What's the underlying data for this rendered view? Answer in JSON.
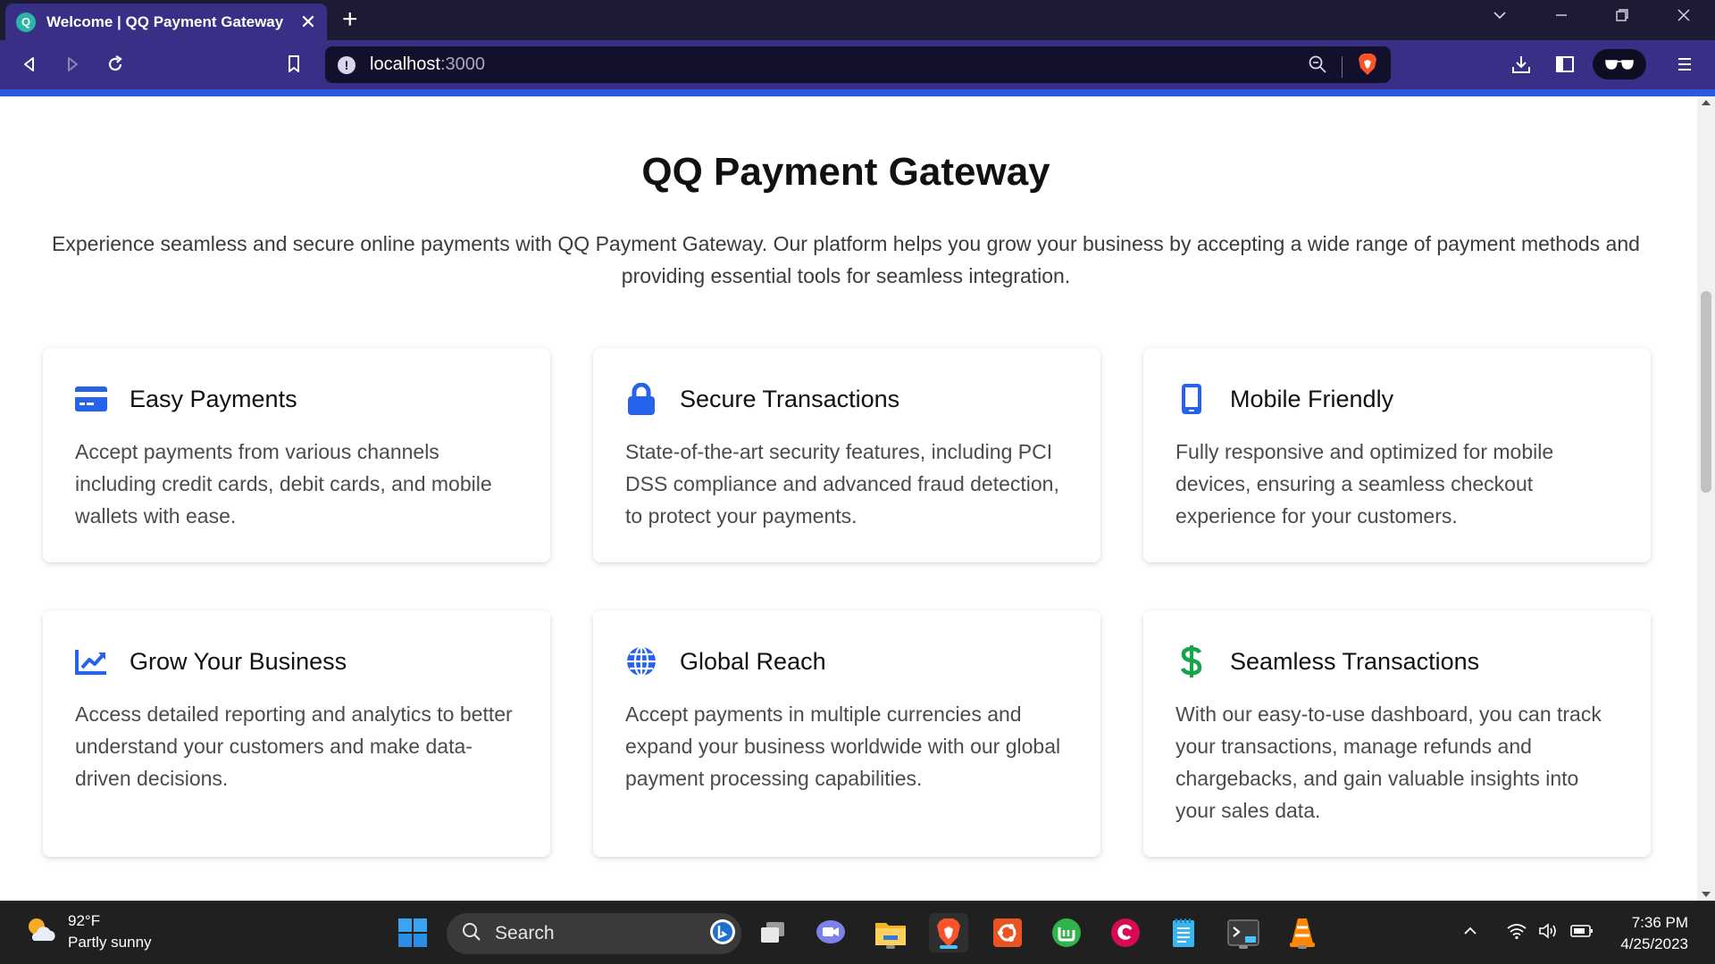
{
  "browser": {
    "tab_title": "Welcome | QQ Payment Gateway",
    "tab_favicon_letter": "Q",
    "new_tab_symbol": "+",
    "close_symbol": "✕",
    "url_host": "localhost",
    "url_port": ":3000",
    "accent_color": "#2c57e0"
  },
  "hero": {
    "title": "QQ Payment Gateway",
    "subtitle": "Experience seamless and secure online payments with QQ Payment Gateway. Our platform helps you grow your business by accepting a wide range of payment methods and providing essential tools for seamless integration."
  },
  "features": [
    {
      "icon": "credit-card-icon",
      "title": "Easy Payments",
      "description": "Accept payments from various channels including credit cards, debit cards, and mobile wallets with ease."
    },
    {
      "icon": "lock-icon",
      "title": "Secure Transactions",
      "description": "State-of-the-art security features, including PCI DSS compliance and advanced fraud detection, to protect your payments."
    },
    {
      "icon": "mobile-phone-icon",
      "title": "Mobile Friendly",
      "description": "Fully responsive and optimized for mobile devices, ensuring a seamless checkout experience for your customers."
    },
    {
      "icon": "trending-chart-icon",
      "title": "Grow Your Business",
      "description": "Access detailed reporting and analytics to better understand your customers and make data-driven decisions."
    },
    {
      "icon": "globe-icon",
      "title": "Global Reach",
      "description": "Accept payments in multiple currencies and expand your business worldwide with our global payment processing capabilities."
    },
    {
      "icon": "dollar-sign-icon",
      "title": "Seamless Transactions",
      "description": "With our easy-to-use dashboard, you can track your transactions, manage refunds and chargebacks, and gain valuable insights into your sales data."
    }
  ],
  "taskbar": {
    "weather_temp": "92°F",
    "weather_desc": "Partly sunny",
    "search_placeholder": "Search",
    "time": "7:36 PM",
    "date": "4/25/2023"
  },
  "colors": {
    "icon_blue": "#2563eb",
    "icon_green": "#16a34a"
  }
}
